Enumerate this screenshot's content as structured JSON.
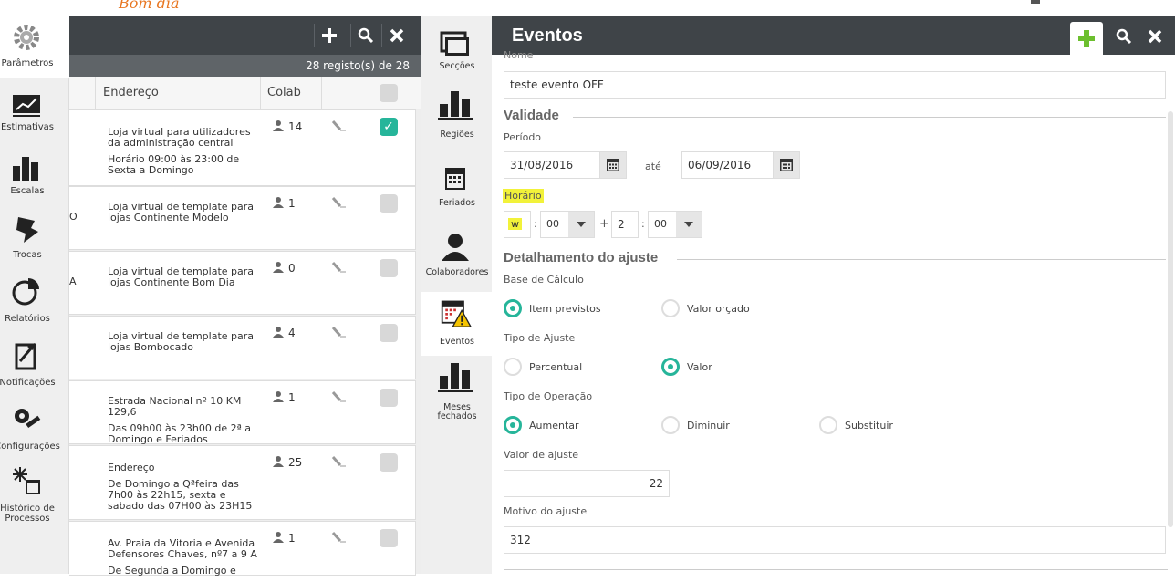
{
  "app": {
    "logo": "Bom dia"
  },
  "sidebar": {
    "items": [
      {
        "label": "Parâmetros",
        "icon": "gear-icon"
      },
      {
        "label": "Estimativas",
        "icon": "trend-chart-icon"
      },
      {
        "label": "Escalas",
        "icon": "bar-chart-icon"
      },
      {
        "label": "Trocas",
        "icon": "swap-icon"
      },
      {
        "label": "Relatórios",
        "icon": "pie-chart-icon"
      },
      {
        "label": "Notificações",
        "icon": "notification-icon"
      },
      {
        "label": "Configurações",
        "icon": "wrench-gear-icon"
      },
      {
        "label": "Histórico de",
        "label2": "Processos",
        "icon": "history-calendar-icon"
      }
    ]
  },
  "list": {
    "count_text": "28  registo(s) de  28",
    "columns": {
      "address": "Endereço",
      "colab": "Colab"
    },
    "rows": [
      {
        "frag": "",
        "lines": [
          "Loja virtual para utilizadores da administração central",
          "Horário 09:00 às 23:00 de Sexta a Domingo"
        ],
        "colab": "14",
        "checked": true
      },
      {
        "frag": "O",
        "lines": [
          "Loja virtual de template para lojas Continente Modelo"
        ],
        "colab": "1",
        "checked": false
      },
      {
        "frag": "A",
        "lines": [
          "Loja virtual de template para lojas Continente Bom Dia"
        ],
        "colab": "0",
        "checked": false
      },
      {
        "frag": "",
        "lines": [
          "Loja virtual de template para lojas Bombocado"
        ],
        "colab": "4",
        "checked": false
      },
      {
        "frag": "",
        "lines": [
          "Estrada Nacional nº 10 KM 129,6",
          "Das 09h00 às 23h00 de 2ª a Domingo e Feriados"
        ],
        "colab": "1",
        "checked": false
      },
      {
        "frag": "",
        "lines": [
          "Endereço",
          "De Domingo a Qªfeira das 7h00 às 22h15, sexta e sabado das 07H00 às 23H15"
        ],
        "colab": "25",
        "checked": false
      },
      {
        "frag": "",
        "lines": [
          "Av. Praia da Vitoria e Avenida Defensores Chaves, nº7 a 9 A",
          "De Segunda a Domingo e"
        ],
        "colab": "1",
        "checked": false
      }
    ]
  },
  "midnav": {
    "items": [
      {
        "label": "Secções",
        "icon": "sections-icon"
      },
      {
        "label": "Regiões",
        "icon": "regions-chart-icon"
      },
      {
        "label": "Feriados",
        "icon": "holiday-calendar-icon"
      },
      {
        "label": "Colaboradores",
        "icon": "collaborator-icon"
      },
      {
        "label": "Eventos",
        "icon": "event-calendar-warning-icon"
      },
      {
        "label": "Meses",
        "label2": "fechados",
        "icon": "closed-months-chart-icon"
      }
    ]
  },
  "form": {
    "title": "Eventos",
    "nome_label": "Nome",
    "nome_value": "teste evento OFF",
    "validade_title": "Validade",
    "periodo_label": "Período",
    "date_from": "31/08/2016",
    "ate_label": "até",
    "date_to": "06/09/2016",
    "horario_label": "Horário",
    "hour_a": "w",
    "min_a": "00",
    "plus": "+",
    "hour_b": "2",
    "min_b": "00",
    "detalhe_title": "Detalhamento do ajuste",
    "base_label": "Base de Cálculo",
    "base_options": [
      "Item previstos",
      "Valor orçado"
    ],
    "tipo_ajuste_label": "Tipo de Ajuste",
    "tipo_ajuste_options": [
      "Percentual",
      "Valor"
    ],
    "tipo_oper_label": "Tipo de Operação",
    "tipo_oper_options": [
      "Aumentar",
      "Diminuir",
      "Substituir"
    ],
    "valor_label": "Valor de ajuste",
    "valor_value": "22",
    "motivo_label": "Motivo do ajuste",
    "motivo_value": "312"
  },
  "colors": {
    "accent": "#26b59a",
    "toolbar": "#3f4448",
    "brand": "#e87722",
    "add": "#6cbf2e",
    "highlight": "#f2f23a"
  }
}
